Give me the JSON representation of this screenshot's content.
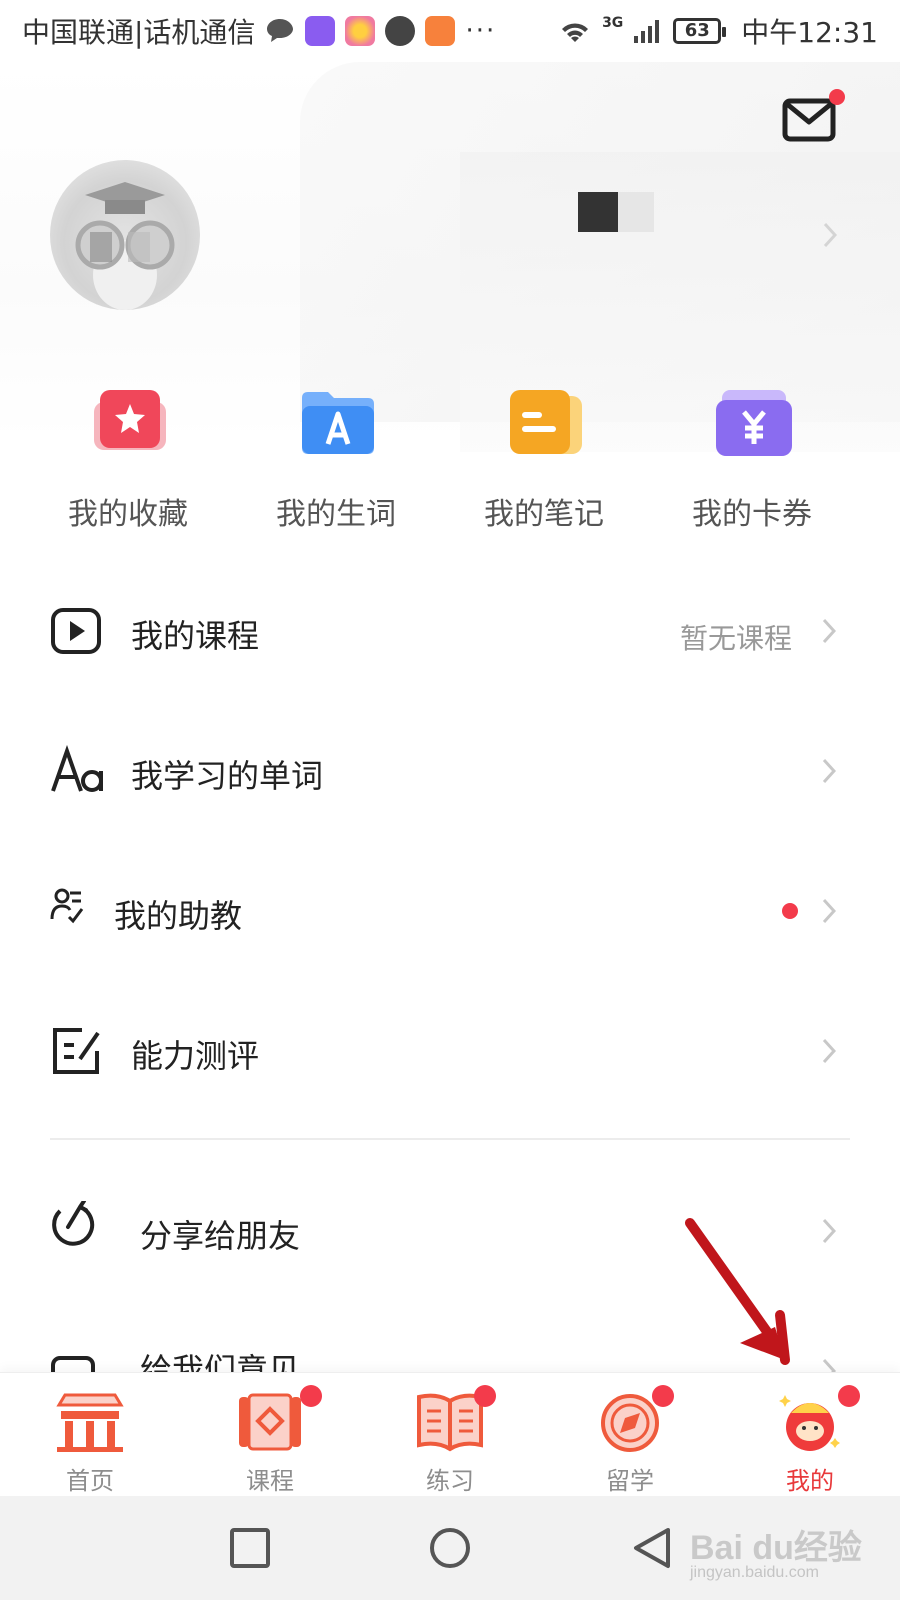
{
  "status_bar": {
    "carrier": "中国联通|话机通信",
    "network": "3G",
    "battery": "63",
    "time": "中午12:31",
    "more": "···"
  },
  "header": {
    "mail_icon": "mail-icon",
    "has_notification": true
  },
  "quick_actions": [
    {
      "label": "我的收藏",
      "icon": "star-folder-icon",
      "color": "#f0475a"
    },
    {
      "label": "我的生词",
      "icon": "letter-a-folder-icon",
      "color": "#3f8ef4"
    },
    {
      "label": "我的笔记",
      "icon": "note-icon",
      "color": "#f5a623"
    },
    {
      "label": "我的卡券",
      "icon": "yuan-coupon-icon",
      "color": "#8a6cf0"
    }
  ],
  "menu": [
    {
      "label": "我的课程",
      "icon": "play-icon",
      "value": "暂无课程",
      "dot": false
    },
    {
      "label": "我学习的单词",
      "icon": "aa-font-icon",
      "value": "",
      "dot": false
    },
    {
      "label": "我的助教",
      "icon": "assistant-icon",
      "value": "",
      "dot": true
    },
    {
      "label": "能力测评",
      "icon": "edit-icon",
      "value": "",
      "dot": false
    },
    {
      "label": "分享给朋友",
      "icon": "share-icon",
      "value": "",
      "dot": false
    },
    {
      "label": "给我们意见",
      "icon": "feedback-icon",
      "value": "",
      "dot": false
    }
  ],
  "tabs": [
    {
      "label": "首页",
      "icon": "home-gate-icon",
      "dot": false,
      "active": false
    },
    {
      "label": "课程",
      "icon": "scroll-icon",
      "dot": true,
      "active": false
    },
    {
      "label": "练习",
      "icon": "book-icon",
      "dot": true,
      "active": false
    },
    {
      "label": "留学",
      "icon": "compass-icon",
      "dot": true,
      "active": false
    },
    {
      "label": "我的",
      "icon": "mascot-icon",
      "dot": true,
      "active": true
    }
  ],
  "colors": {
    "accent": "#e8393b",
    "badge": "#f33b4b",
    "text": "#222222",
    "muted": "#999999"
  },
  "watermark": {
    "brand": "Bai du经验",
    "url": "jingyan.baidu.com"
  }
}
